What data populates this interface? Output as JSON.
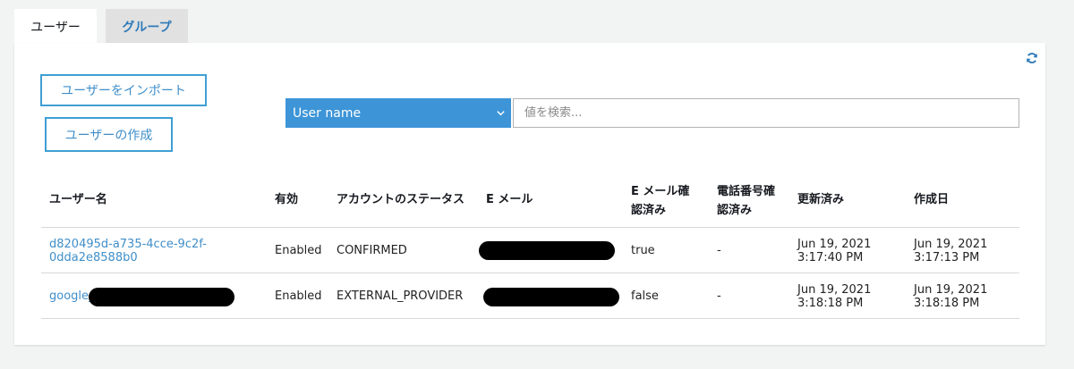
{
  "tabs": {
    "users": "ユーザー",
    "groups": "グループ"
  },
  "actions": {
    "import": "ユーザーをインポート",
    "create": "ユーザーの作成"
  },
  "filter": {
    "attribute": "User name",
    "placeholder": "値を検索..."
  },
  "icons": {
    "refresh": "refresh-icon",
    "dropdown": "chevron-down-icon"
  },
  "colors": {
    "accent": "#3d95d8",
    "link": "#3f8ec9",
    "button_border": "#3f9fd4"
  },
  "table": {
    "headers": {
      "username": "ユーザー名",
      "enabled": "有効",
      "account_status": "アカウントのステータス",
      "email": "E メール",
      "email_verified_1": "E メール確",
      "email_verified_2": "認済み",
      "phone_verified_1": "電話番号確",
      "phone_verified_2": "認済み",
      "updated": "更新済み",
      "created": "作成日"
    },
    "rows": [
      {
        "username_1": "d820495d-a735-4cce-9c2f-",
        "username_2": "0dda2e8588b0",
        "enabled": "Enabled",
        "status": "CONFIRMED",
        "email_verified": "true",
        "phone_verified": "-",
        "updated_date": "Jun 19, 2021",
        "updated_time": "3:17:40 PM",
        "created_date": "Jun 19, 2021",
        "created_time": "3:17:13 PM"
      },
      {
        "username_prefix": "google_",
        "enabled": "Enabled",
        "status": "EXTERNAL_PROVIDER",
        "email_verified": "false",
        "phone_verified": "-",
        "updated_date": "Jun 19, 2021",
        "updated_time": "3:18:18 PM",
        "created_date": "Jun 19, 2021",
        "created_time": "3:18:18 PM"
      }
    ]
  }
}
